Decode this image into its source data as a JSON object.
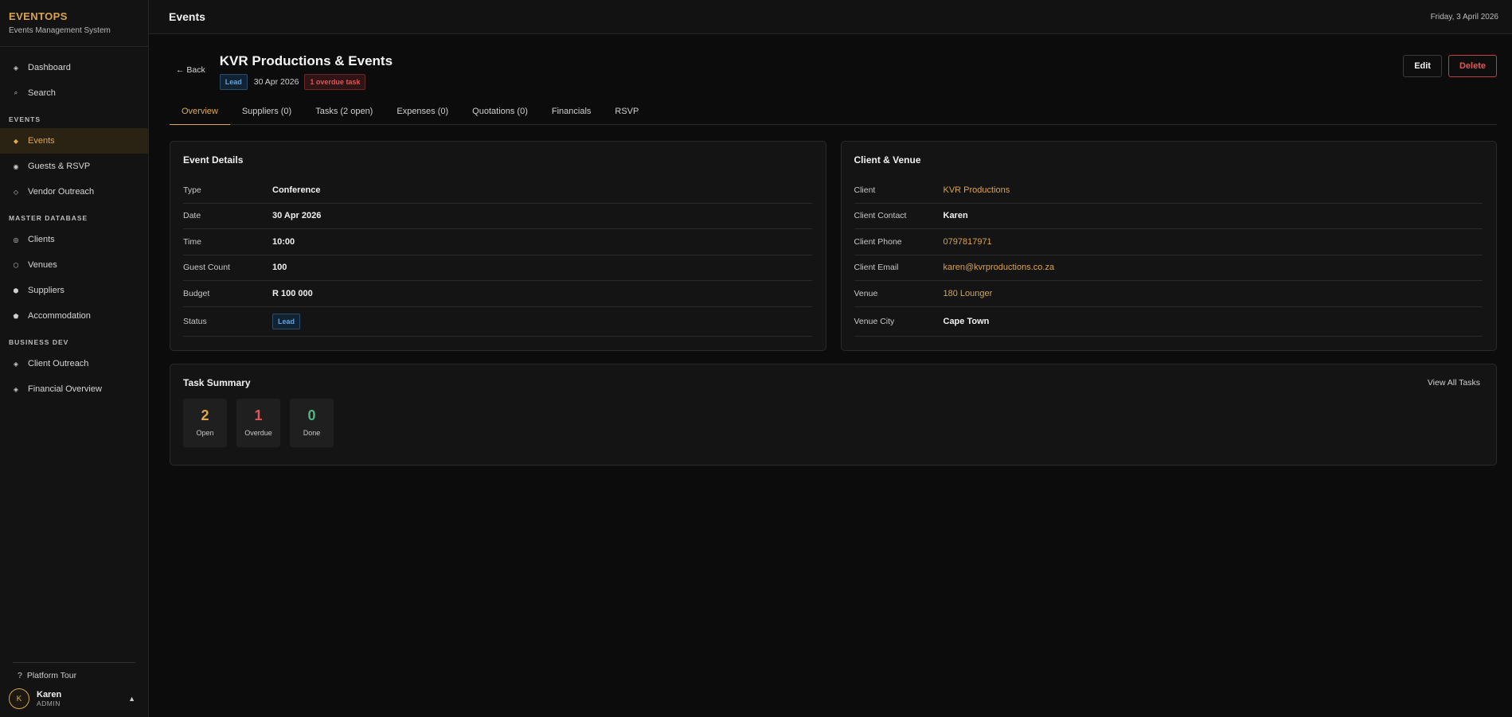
{
  "brand": {
    "title": "EVENTOPS",
    "subtitle": "Events Management System"
  },
  "nav": {
    "top": [
      {
        "label": "Dashboard",
        "icon": "dashboard-icon"
      },
      {
        "label": "Search",
        "icon": "search-icon"
      }
    ],
    "events_section": "EVENTS",
    "events": [
      {
        "label": "Events",
        "icon": "events-icon",
        "active": true
      },
      {
        "label": "Guests & RSVP",
        "icon": "guests-icon"
      },
      {
        "label": "Vendor Outreach",
        "icon": "vendor-icon"
      }
    ],
    "master_section": "MASTER DATABASE",
    "master": [
      {
        "label": "Clients",
        "icon": "clients-icon"
      },
      {
        "label": "Venues",
        "icon": "venues-icon"
      },
      {
        "label": "Suppliers",
        "icon": "suppliers-icon"
      },
      {
        "label": "Accommodation",
        "icon": "accommodation-icon"
      }
    ],
    "bizdev_section": "BUSINESS DEV",
    "bizdev": [
      {
        "label": "Client Outreach",
        "icon": "outreach-icon"
      },
      {
        "label": "Financial Overview",
        "icon": "financial-icon"
      }
    ]
  },
  "sidebar_bottom": {
    "tour_label": "Platform Tour",
    "user_initial": "K",
    "user_name": "Karen",
    "user_role": "ADMIN"
  },
  "topbar": {
    "title": "Events",
    "date": "Friday, 3 April 2026"
  },
  "event": {
    "back_label": "← Back",
    "title": "KVR Productions & Events",
    "status_badge": "Lead",
    "date": "30 Apr 2026",
    "overdue_badge": "1 overdue task",
    "edit_label": "Edit",
    "delete_label": "Delete"
  },
  "tabs": [
    {
      "label": "Overview",
      "active": true
    },
    {
      "label": "Suppliers (0)"
    },
    {
      "label": "Tasks (2 open)"
    },
    {
      "label": "Expenses (0)"
    },
    {
      "label": "Quotations (0)"
    },
    {
      "label": "Financials"
    },
    {
      "label": "RSVP"
    }
  ],
  "event_details": {
    "title": "Event Details",
    "rows": [
      {
        "label": "Type",
        "value": "Conference"
      },
      {
        "label": "Date",
        "value": "30 Apr 2026"
      },
      {
        "label": "Time",
        "value": "10:00"
      },
      {
        "label": "Guest Count",
        "value": "100"
      },
      {
        "label": "Budget",
        "value": "R 100 000"
      },
      {
        "label": "Status",
        "value": "Lead"
      }
    ]
  },
  "client_venue": {
    "title": "Client & Venue",
    "rows": [
      {
        "label": "Client",
        "value": "KVR Productions"
      },
      {
        "label": "Client Contact",
        "value": "Karen"
      },
      {
        "label": "Client Phone",
        "value": "0797817971"
      },
      {
        "label": "Client Email",
        "value": "karen@kvrproductions.co.za"
      },
      {
        "label": "Venue",
        "value": "180 Lounger"
      },
      {
        "label": "Venue City",
        "value": "Cape Town"
      }
    ]
  },
  "task_summary": {
    "title": "Task Summary",
    "view_all": "View All Tasks",
    "stats": [
      {
        "value": "2",
        "label": "Open",
        "color": "#e0a94a"
      },
      {
        "value": "1",
        "label": "Overdue",
        "color": "#e05555"
      },
      {
        "value": "0",
        "label": "Done",
        "color": "#4fb87a"
      }
    ]
  },
  "colors": {
    "accent": "#e0a94a",
    "danger": "#e05555",
    "success": "#4fb87a",
    "info": "#5fa5e0"
  }
}
